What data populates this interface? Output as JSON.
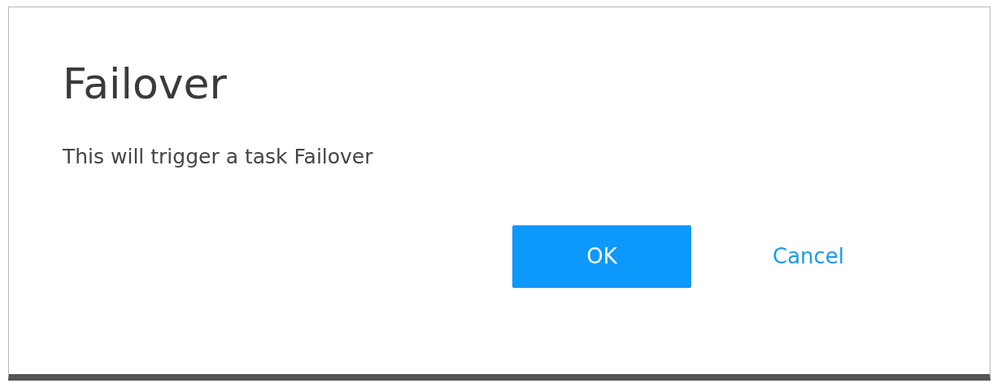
{
  "dialog": {
    "title": "Failover",
    "message": "This will trigger a task Failover",
    "buttons": [
      {
        "kind": "primary",
        "label": "OK"
      },
      {
        "kind": "link",
        "label": "Cancel"
      }
    ]
  }
}
